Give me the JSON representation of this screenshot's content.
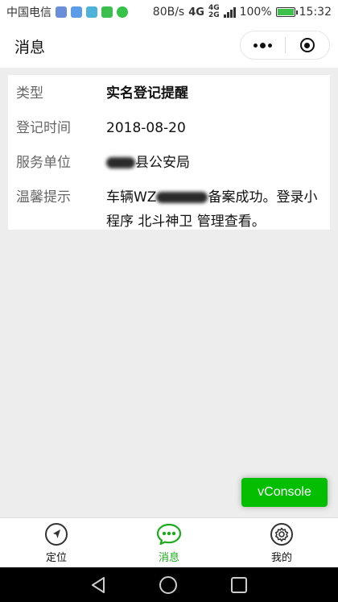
{
  "status_bar": {
    "carrier": "中国电信",
    "speed": "80B/s",
    "net_top": "4G",
    "net_mid": "4G",
    "net_bot": "2G",
    "battery_level": 100,
    "battery_text": "100%",
    "time": "15:32"
  },
  "header": {
    "title": "消息"
  },
  "card": {
    "rows": [
      {
        "label": "类型",
        "value": "实名登记提醒"
      },
      {
        "label": "登记时间",
        "value": "2018-08-20"
      },
      {
        "label": "服务单位",
        "value_suffix": "县公安局"
      },
      {
        "label": "温馨提示",
        "value_prefix": "车辆WZ",
        "value_suffix": "备案成功。登录小程序 北斗神卫 管理查看。"
      }
    ]
  },
  "vconsole": {
    "label": "vConsole"
  },
  "tabbar": {
    "tabs": [
      {
        "label": "定位",
        "icon": "navigation-arrow-icon",
        "active": false
      },
      {
        "label": "消息",
        "icon": "chat-dots-icon",
        "active": true
      },
      {
        "label": "我的",
        "icon": "gear-icon",
        "active": false
      }
    ],
    "active_color": "#1aad19"
  },
  "colors": {
    "accent": "#1aad19",
    "vconsole": "#04be02",
    "background": "#ededed"
  }
}
